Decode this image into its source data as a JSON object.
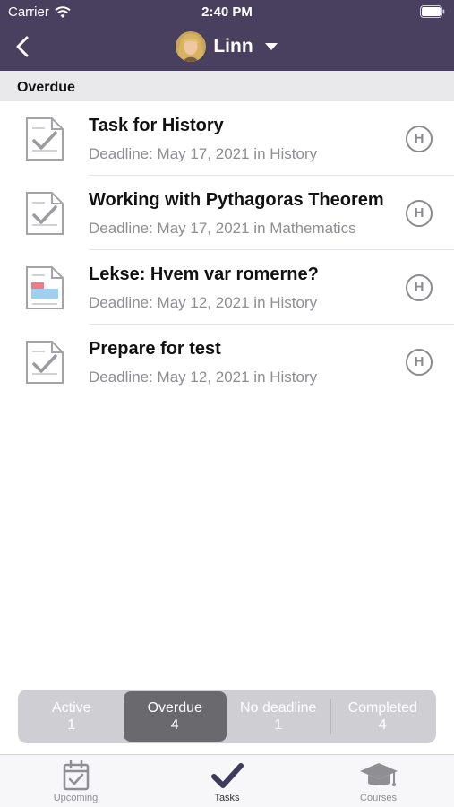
{
  "status_bar": {
    "carrier": "Carrier",
    "time": "2:40 PM"
  },
  "nav": {
    "user_name": "Linn"
  },
  "section": {
    "title": "Overdue"
  },
  "tasks": [
    {
      "title": "Task for History",
      "subtitle": "Deadline: May 17, 2021 in History",
      "badge": "H",
      "icon": "assignment-check-icon"
    },
    {
      "title": "Working with Pythagoras Theorem",
      "subtitle": "Deadline: May 17, 2021 in Mathematics",
      "badge": "H",
      "icon": "assignment-check-icon"
    },
    {
      "title": "Lekse: Hvem var romerne?",
      "subtitle": "Deadline: May 12, 2021 in History",
      "badge": "H",
      "icon": "document-colored-icon"
    },
    {
      "title": "Prepare for test",
      "subtitle": "Deadline: May 12, 2021 in History",
      "badge": "H",
      "icon": "assignment-check-icon"
    }
  ],
  "filters": [
    {
      "label": "Active",
      "count": "1"
    },
    {
      "label": "Overdue",
      "count": "4",
      "selected": true
    },
    {
      "label": "No deadline",
      "count": "1"
    },
    {
      "label": "Completed",
      "count": "4"
    }
  ],
  "tabbar": [
    {
      "label": "Upcoming",
      "icon": "calendar-check-icon"
    },
    {
      "label": "Tasks",
      "icon": "checkmark-icon",
      "selected": true
    },
    {
      "label": "Courses",
      "icon": "graduation-cap-icon"
    }
  ],
  "colors": {
    "header": "#48405e",
    "section_bg": "#e9e9ec",
    "segment_bg": "#cfcfd3",
    "segment_selected": "#6a6a6e"
  }
}
